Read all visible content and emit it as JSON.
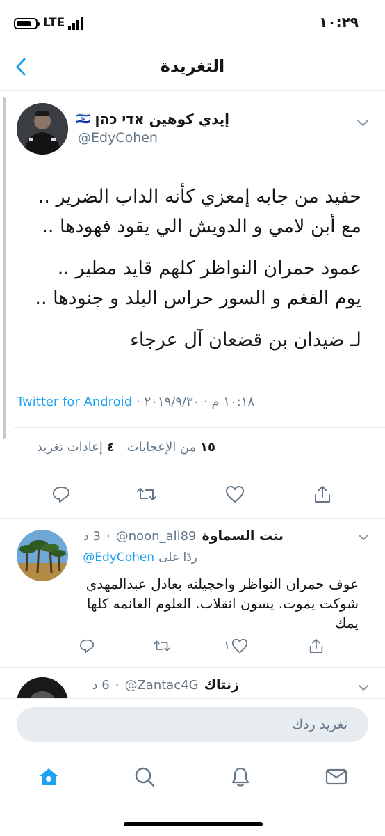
{
  "status_bar": {
    "carrier": "LTE",
    "time": "١٠:٢٩"
  },
  "header": {
    "title": "التغريدة",
    "back_icon": "chevron-left-icon"
  },
  "main_tweet": {
    "display_name": "إيدي كوهين אדי כהן",
    "flag": "🇮🇱",
    "handle": "@EdyCohen",
    "lines": [
      "حفيد من جابه إمعزي كأنه الداب الضرير ..",
      "مع أبن لامي و الدويش الي يقود فهودها ..",
      "عمود حمران النواظر كلهم قايد مطير ..",
      "يوم الفغم و السور حراس البلد و جنودها ..",
      "لـ ضيدان بن قضعان آل عرجاء"
    ],
    "source": "Twitter for Android",
    "timestamp": "١٠:١٨ م · ٢٠١٩/٩/٣٠ ·",
    "likes_count": "١٥",
    "likes_label": "من الإعجابات",
    "retweets_count": "٤",
    "retweets_label": "إعادات تغريد"
  },
  "reply": {
    "display_name": "بنت السماوة",
    "handle": "@noon_ali89",
    "time": "3 د",
    "replying_label": "ردًا على",
    "replying_to": "@EdyCohen",
    "text": "عوف حمران النواظر واحچيلنه بعادل عبدالمهدي شوكت يموت. يسون انقلاب. العلوم الغانمه كلها يمك",
    "likes": "١"
  },
  "next_reply": {
    "display_name": "زنتاك",
    "handle": "@Zantac4G",
    "time": "6 د"
  },
  "compose": {
    "placeholder": "تغريد ردك"
  },
  "tab_bar": {
    "items": [
      "home-icon",
      "search-icon",
      "bell-icon",
      "mail-icon"
    ]
  },
  "colors": {
    "accent": "#1da1f2",
    "muted": "#657786",
    "divider": "#e6ecf0"
  }
}
